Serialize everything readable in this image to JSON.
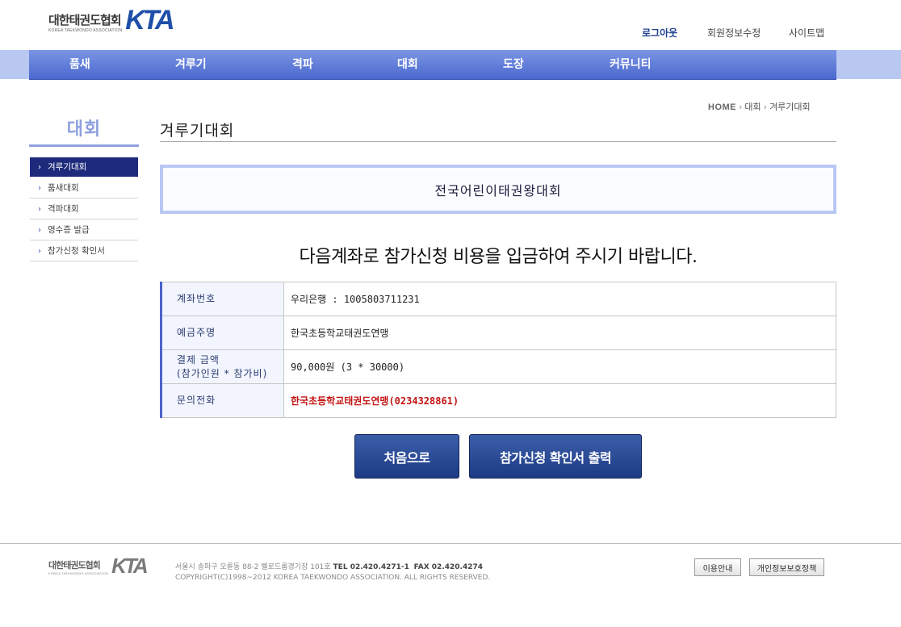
{
  "header": {
    "logo_ko": "대한태권도협회",
    "logo_en": "KOREA TAEKWONDO ASSOCIATION",
    "logo_mark": "KTA",
    "links": [
      "로그아웃",
      "회원정보수정",
      "사이트맵"
    ]
  },
  "nav": {
    "items": [
      "품새",
      "겨루기",
      "격파",
      "대회",
      "도장",
      "커뮤니티"
    ]
  },
  "sidebar": {
    "title": "대회",
    "items": [
      "겨루기대회",
      "품새대회",
      "격파대회",
      "영수증 발급",
      "참가신청 확인서"
    ],
    "active_index": 0
  },
  "breadcrumb": {
    "home": "HOME",
    "items": [
      "대회",
      "겨루기대회"
    ]
  },
  "main": {
    "page_title": "겨루기대회",
    "event_name": "전국어린이태권왕대회",
    "notice": "다음계좌로 참가신청 비용을 입금하여 주시기 바랍니다.",
    "rows": [
      {
        "label": "계좌번호",
        "value": "우리은행 : 1005803711231"
      },
      {
        "label": "예금주명",
        "value": "한국초등학교태권도연맹"
      },
      {
        "label": "결제 금액",
        "label2": "(참가인원 * 참가비)",
        "value": "90,000원 (3 * 30000)"
      },
      {
        "label": "문의전화",
        "value": "한국초등학교태권도연맹(0234328861)"
      }
    ],
    "buttons": {
      "home": "처음으로",
      "print": "참가신청 확인서 출력"
    }
  },
  "footer": {
    "address": "서울시 송파구 오륜동 88-2 벨로드롬경기장 101호",
    "tel": "TEL 02.420.4271-1",
    "fax": "FAX 02.420.4274",
    "copyright": "COPYRIGHT(C)1998~2012 KOREA TAEKWONDO ASSOCIATION. ALL RIGHTS RESERVED.",
    "buttons": [
      "이용안내",
      "개인정보보호정책"
    ]
  },
  "colors": {
    "nav_top": "#7b95e3",
    "nav_bottom": "#4b68cf",
    "sidebar_active": "#1e2b7c",
    "button": "#1d3b85",
    "highlight_red": "#c31414"
  }
}
